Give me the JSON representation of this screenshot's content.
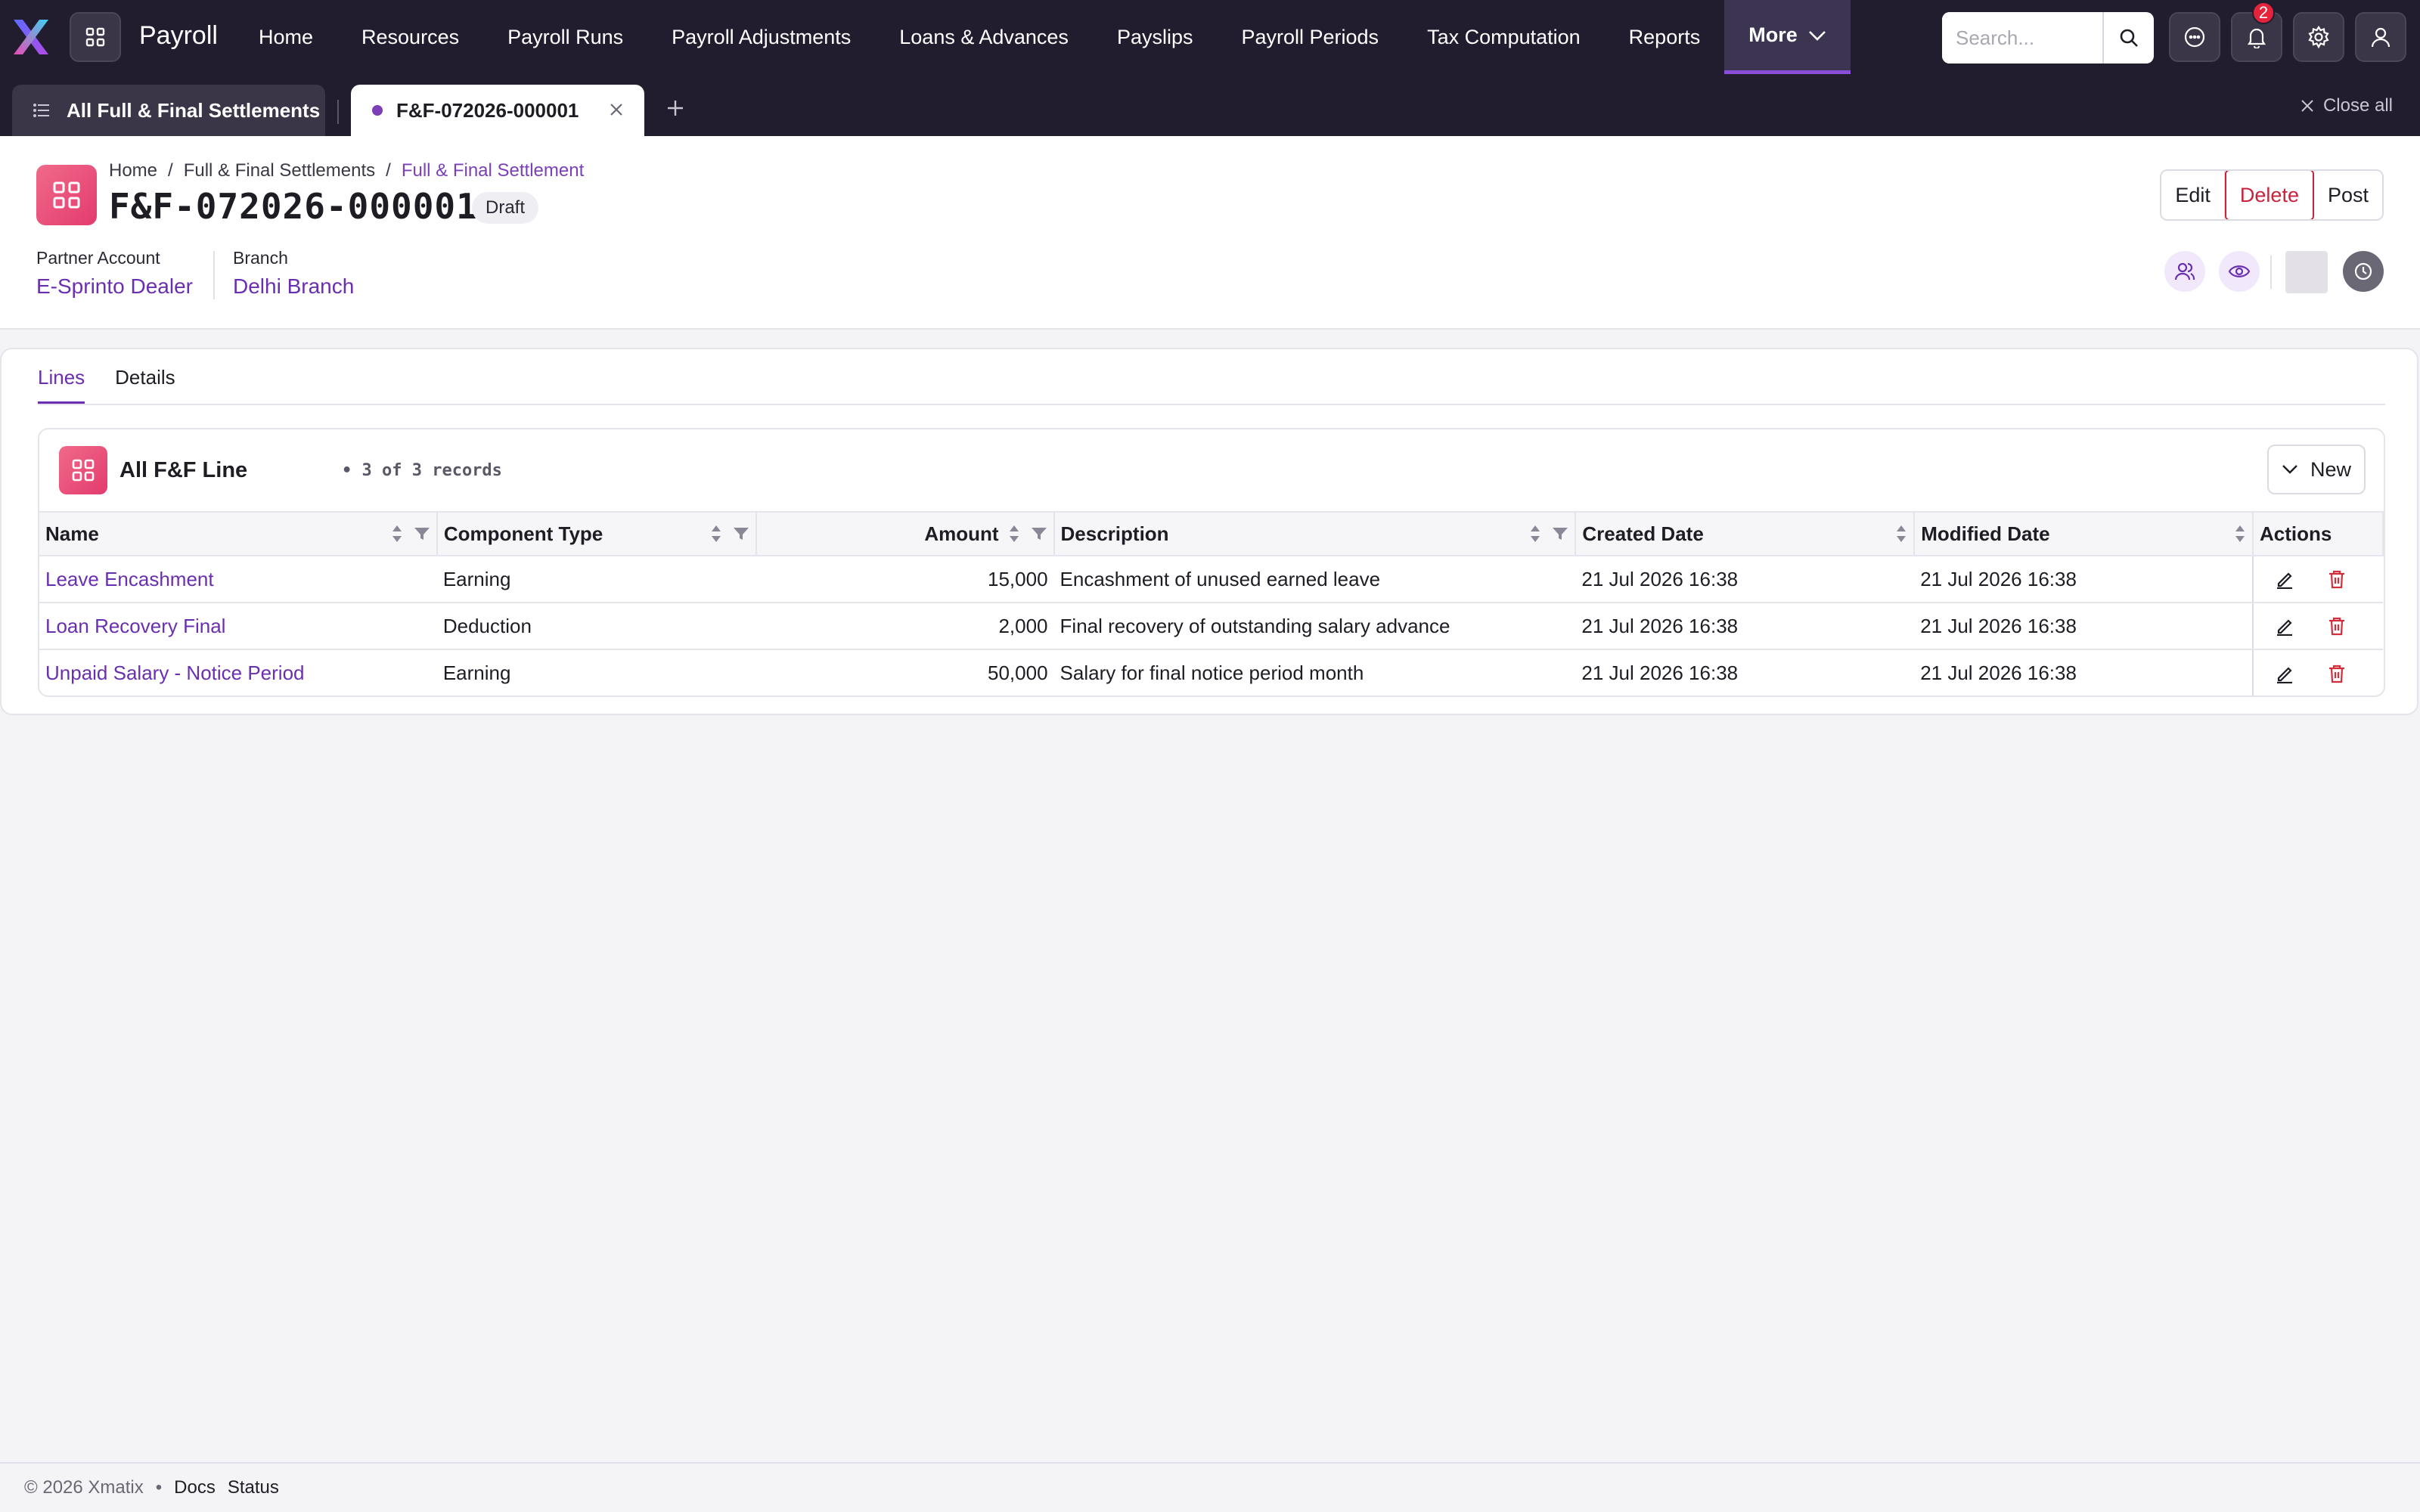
{
  "topnav": {
    "app_title": "Payroll",
    "items": [
      {
        "label": "Home"
      },
      {
        "label": "Resources"
      },
      {
        "label": "Payroll Runs"
      },
      {
        "label": "Payroll Adjustments"
      },
      {
        "label": "Loans & Advances"
      },
      {
        "label": "Payslips"
      },
      {
        "label": "Payroll Periods"
      },
      {
        "label": "Tax Computation"
      },
      {
        "label": "Reports"
      }
    ],
    "more_label": "More",
    "search_placeholder": "Search...",
    "notification_count": "2",
    "accent_color": "#8a4fd8"
  },
  "tabstrip": {
    "list_tab": "All Full & Final Settlements",
    "active_tab": "F&F-072026-000001",
    "close_all": "Close all"
  },
  "header": {
    "breadcrumb": [
      "Home",
      "Full & Final Settlements",
      "Full & Final Settlement"
    ],
    "breadcrumb_sep": "/",
    "record_title": "F&F-072026-000001",
    "status": "Draft",
    "partner_account_label": "Partner Account",
    "partner_account_value": "E-Sprinto Dealer",
    "branch_label": "Branch",
    "branch_value": "Delhi Branch",
    "actions": {
      "edit": "Edit",
      "delete": "Delete",
      "post": "Post"
    }
  },
  "content": {
    "tabs": [
      {
        "label": "Lines"
      },
      {
        "label": "Details"
      }
    ],
    "active_tab": "Lines",
    "list_title": "All F&F Line",
    "record_count": "• 3 of 3 records",
    "new_button": "New",
    "columns": [
      "Name",
      "Component Type",
      "Amount",
      "Description",
      "Created Date",
      "Modified Date",
      "Actions"
    ],
    "rows": [
      {
        "name": "Leave Encashment",
        "component_type": "Earning",
        "amount": "15,000",
        "description": "Encashment of unused earned leave",
        "created": "21 Jul 2026 16:38",
        "modified": "21 Jul 2026 16:38"
      },
      {
        "name": "Loan Recovery Final",
        "component_type": "Deduction",
        "amount": "2,000",
        "description": "Final recovery of outstanding salary advance",
        "created": "21 Jul 2026 16:38",
        "modified": "21 Jul 2026 16:38"
      },
      {
        "name": "Unpaid Salary - Notice Period",
        "component_type": "Earning",
        "amount": "50,000",
        "description": "Salary for final notice period month",
        "created": "21 Jul 2026 16:38",
        "modified": "21 Jul 2026 16:38"
      }
    ]
  },
  "footer": {
    "copyright": "© 2026 Xmatix",
    "bullet": "•",
    "links": [
      "Docs",
      "Status"
    ]
  },
  "icons": [
    "logo-x-icon",
    "apps-grid-icon",
    "chevron-down-icon",
    "search-icon",
    "chat-icon",
    "bell-icon",
    "gear-icon",
    "user-icon",
    "list-icon",
    "close-icon",
    "plus-icon",
    "users-icon",
    "eye-icon",
    "history-icon",
    "sort-icon",
    "filter-icon",
    "edit-icon",
    "trash-icon"
  ]
}
